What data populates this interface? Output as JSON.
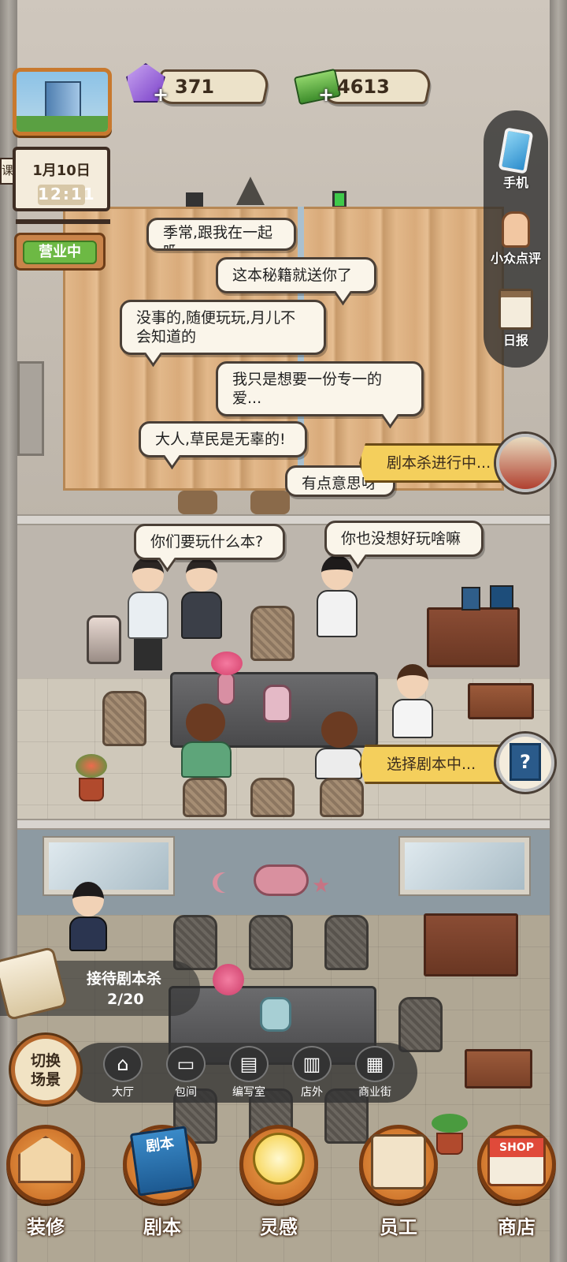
{
  "hud": {
    "gems": "371",
    "cash": "4613",
    "plus": "+",
    "calendar_date": "1月10日",
    "calendar_time": "12:11",
    "side_tab": "课",
    "open_status": "营业中"
  },
  "side_menu": {
    "phone": "手机",
    "reviews": "小众点评",
    "daily": "日报"
  },
  "top_room_bubbles": [
    "季常,跟我在一起吧",
    "这本秘籍就送你了",
    "没事的,随便玩玩,月儿不会知道的",
    "我只是想要一份专一的爱...",
    "大人,草民是无辜的!",
    "有点意思呀"
  ],
  "room1_bubbles": [
    "你们要玩什么本?",
    "你也没想好玩啥嘛"
  ],
  "banners": {
    "in_progress": "剧本杀进行中...",
    "selecting": "选择剧本中...",
    "selecting_icon": "?"
  },
  "task": {
    "title": "接待剧本杀",
    "count": "2/20"
  },
  "scene_switch": "切换场景",
  "scenes": [
    {
      "label": "大厅",
      "icon": "home-icon"
    },
    {
      "label": "包间",
      "icon": "sofa-icon"
    },
    {
      "label": "编写室",
      "icon": "desk-icon"
    },
    {
      "label": "店外",
      "icon": "storefront-icon"
    },
    {
      "label": "商业街",
      "icon": "shop-street-icon"
    }
  ],
  "bottom_nav": [
    {
      "label": "装修",
      "icon": "house-icon"
    },
    {
      "label": "剧本",
      "icon": "script-book-icon",
      "book_text": "剧本"
    },
    {
      "label": "灵感",
      "icon": "lightbulb-icon"
    },
    {
      "label": "员工",
      "icon": "staff-card-icon"
    },
    {
      "label": "商店",
      "icon": "shop-icon",
      "shop_text": "SHOP"
    }
  ],
  "colors": {
    "accent_orange": "#c46520",
    "banner_yellow": "#f4cf5c",
    "open_green": "#6db944"
  }
}
